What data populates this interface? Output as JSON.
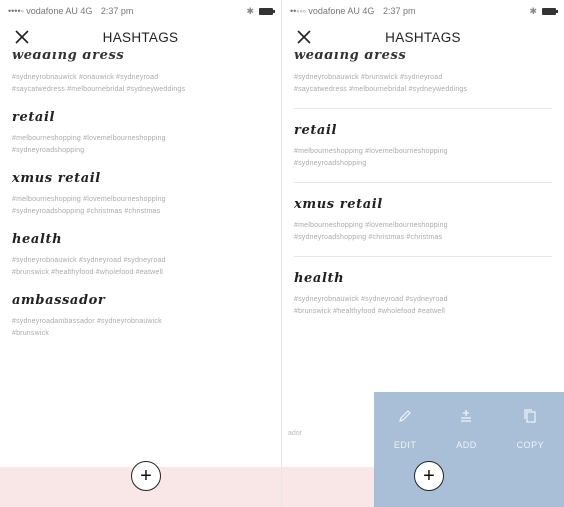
{
  "left": {
    "status": {
      "carrier": "••••◦ vodafone AU 4G",
      "time": "2:37 pm",
      "bt": "✱"
    },
    "title": "HASHTAGS",
    "cut_title": "wedding dress",
    "cut_tags": [
      "#sydneyrobnauwick #onauwick #sydneyroad",
      "#saycatwedress #melbournebridal #sydneyweddings"
    ],
    "entries": [
      {
        "title": "retail",
        "tags": [
          "#melbourneshopping #lovemelbourneshopping",
          "#sydneyroadshopping"
        ]
      },
      {
        "title": "xmus retail",
        "tags": [
          "#melbourneshopping #lovemelbourneshopping",
          "#sydneyroadshopping #christmas #christmas"
        ]
      },
      {
        "title": "health",
        "tags": [
          "#sydneyrobnauwick #sydneyroad #sydneyroad",
          "#brunswick #healthyfood #wholefood #eatwell"
        ]
      },
      {
        "title": "ambassador",
        "tags": [
          "#sydneyroadambassador #sydneyrobnauwick",
          "#brunswick"
        ]
      }
    ],
    "fab": "+"
  },
  "right": {
    "status": {
      "carrier": "••◦◦◦ vodafone AU 4G",
      "time": "2:37 pm",
      "bt": "✱"
    },
    "title": "HASHTAGS",
    "cut_title": "wedding dress",
    "cut_tags": [
      "#sydneyrobnauwick #brunswick #sydneyroad",
      "#saycatwedress #melbournebridal #sydneyweddings"
    ],
    "entries": [
      {
        "title": "retail",
        "tags": [
          "#melbourneshopping #lovemelbourneshopping",
          "#sydneyroadshopping"
        ]
      },
      {
        "title": "xmus retail",
        "tags": [
          "#melbourneshopping #lovemelbourneshopping",
          "#sydneyroadshopping #christmas #christmas"
        ]
      },
      {
        "title": "health",
        "tags": [
          "#sydneyrobnauwick #sydneyroad #sydneyroad",
          "#brunswick #healthyfood #wholefood #eatwell"
        ]
      }
    ],
    "ghost": "ador",
    "actions": [
      {
        "label": "EDIT",
        "icon": "pencil-icon"
      },
      {
        "label": "ADD",
        "icon": "add-to-list-icon"
      },
      {
        "label": "COPY",
        "icon": "copy-icon"
      }
    ],
    "fab": "+"
  },
  "colors": {
    "band": "#f9e7e7",
    "swipe_panel": "#a9bfd7"
  }
}
